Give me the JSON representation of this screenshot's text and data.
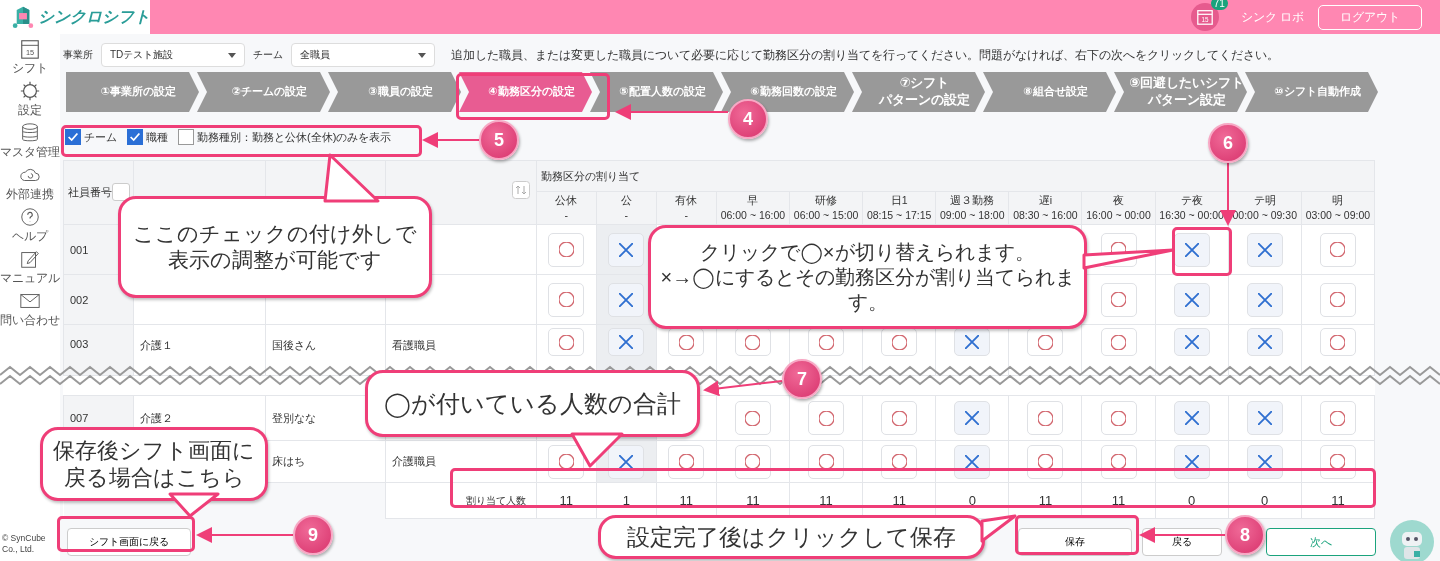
{
  "header": {
    "logo": "シンクロシフト",
    "calendar_day": "15",
    "badge": "71",
    "user": "シンク ロボ",
    "logout": "ログアウト"
  },
  "sidebar": [
    {
      "kind": "calendar",
      "label": "シフト",
      "icon_text": "15"
    },
    {
      "kind": "gear",
      "label": "設定"
    },
    {
      "kind": "database",
      "label": "マスタ管理"
    },
    {
      "kind": "cloud",
      "label": "外部連携"
    },
    {
      "kind": "help",
      "label": "ヘルプ"
    },
    {
      "kind": "manual",
      "label": "マニュアル"
    },
    {
      "kind": "mail",
      "label": "問い合わせ"
    }
  ],
  "filters": [
    {
      "label": "事業所",
      "value": "TDテスト施設"
    },
    {
      "label": "チーム",
      "value": "全職員"
    }
  ],
  "instruction": "追加した職員、または変更した職員について必要に応じて勤務区分の割り当てを行ってください。問題がなければ、右下の次へをクリックしてください。",
  "steps": [
    {
      "lines": [
        "①事業所の設定"
      ],
      "selected": false
    },
    {
      "lines": [
        "②チームの設定"
      ],
      "selected": false
    },
    {
      "lines": [
        "③職員の設定"
      ],
      "selected": false
    },
    {
      "lines": [
        "④勤務区分の設定"
      ],
      "selected": true
    },
    {
      "lines": [
        "⑤配置人数の設定"
      ],
      "selected": false
    },
    {
      "lines": [
        "⑥勤務回数の設定"
      ],
      "selected": false
    },
    {
      "lines": [
        "⑦シフト",
        "パターンの設定"
      ],
      "selected": false
    },
    {
      "lines": [
        "⑧組合せ設定"
      ],
      "selected": false
    },
    {
      "lines": [
        "⑨回避したいシフト",
        "パターン設定"
      ],
      "selected": false
    },
    {
      "lines": [
        "⑩シフト自動作成"
      ],
      "selected": false
    }
  ],
  "display_options": [
    {
      "label": "チーム",
      "checked": true
    },
    {
      "label": "職種",
      "checked": true
    },
    {
      "label": "勤務種別：勤務と公休(全休)のみを表示",
      "checked": false
    }
  ],
  "table": {
    "id_header": "社員番号",
    "group_header": "勤務区分の割り当て",
    "shifts": [
      {
        "name": "公休",
        "time": "-"
      },
      {
        "name": "公",
        "time": "-"
      },
      {
        "name": "有休",
        "time": "-"
      },
      {
        "name": "早",
        "time": "06:00 ~ 16:00"
      },
      {
        "name": "研修",
        "time": "06:00 ~ 15:00"
      },
      {
        "name": "日1",
        "time": "08:15 ~ 17:15"
      },
      {
        "name": "週３勤務",
        "time": "09:00 ~ 18:00"
      },
      {
        "name": "遅i",
        "time": "08:30 ~ 16:00"
      },
      {
        "name": "夜",
        "time": "16:00 ~ 00:00"
      },
      {
        "name": "テ夜",
        "time": "16:30 ~ 00:00"
      },
      {
        "name": "テ明",
        "time": "00:00 ~ 09:30"
      },
      {
        "name": "明",
        "time": "03:00 ~ 09:00"
      }
    ],
    "rows": [
      {
        "id": "001",
        "cells": [
          true,
          false,
          null,
          null,
          null,
          null,
          null,
          null,
          true,
          false,
          false,
          true
        ]
      },
      {
        "id": "002",
        "cells": [
          true,
          false,
          null,
          null,
          null,
          null,
          null,
          null,
          true,
          false,
          false,
          true
        ]
      },
      {
        "id": "003",
        "team": "介護１",
        "name": "国後さん",
        "role": "看護職員",
        "cells": [
          true,
          false,
          true,
          true,
          true,
          true,
          false,
          true,
          true,
          false,
          false,
          true
        ]
      },
      {
        "id": "007",
        "team": "介護２",
        "name": "登別なな",
        "cells": [
          null,
          null,
          null,
          true,
          true,
          true,
          false,
          true,
          true,
          false,
          false,
          true
        ]
      },
      {
        "name": "床はち",
        "role": "介護職員",
        "cells": [
          true,
          false,
          true,
          true,
          true,
          true,
          false,
          true,
          true,
          false,
          false,
          true
        ]
      }
    ],
    "total_label": "割り当て人数",
    "totals": [
      "11",
      "1",
      "11",
      "11",
      "11",
      "11",
      "0",
      "11",
      "11",
      "0",
      "0",
      "11"
    ]
  },
  "buttons": {
    "back_to_shift": "シフト画面に戻る",
    "save": "保存",
    "back": "戻る",
    "next": "次へ"
  },
  "copyright": "© SynCube Co., Ltd.",
  "annotations": {
    "markers": [
      "4",
      "5",
      "6",
      "7",
      "8",
      "9"
    ],
    "callouts": [
      "ここのチェックの付け外しで表示の調整が可能です",
      "クリックで◯×が切り替えられます。\n×→◯にするとその勤務区分が割り当てられます。",
      "◯が付いている人数の合計",
      "保存後シフト画面に戻る場合はこちら",
      "設定完了後はクリックして保存"
    ]
  }
}
